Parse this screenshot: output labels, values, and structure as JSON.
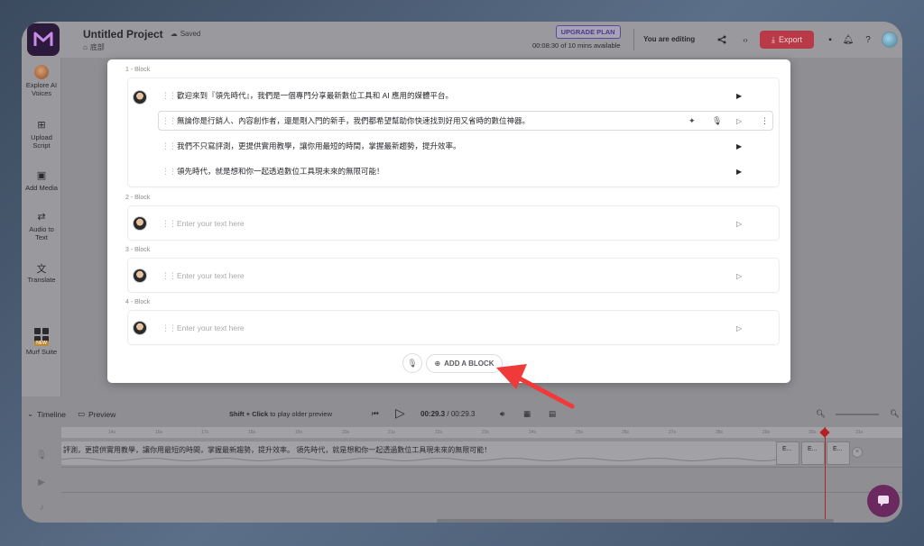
{
  "header": {
    "project_title": "Untitled Project",
    "saved_label": "Saved",
    "breadcrumb": "底部",
    "upgrade_label": "UPGRADE PLAN",
    "time_left": "00:08:30 of 10 mins available",
    "editing_label": "You are editing",
    "export_label": "Export"
  },
  "sidebar": {
    "items": [
      {
        "label": "Explore AI Voices",
        "icon": "voice-avatar-icon"
      },
      {
        "label": "Upload Script",
        "icon": "upload-script-icon"
      },
      {
        "label": "Add Media",
        "icon": "add-media-icon"
      },
      {
        "label": "Audio to Text",
        "icon": "audio-to-text-icon"
      },
      {
        "label": "Translate",
        "icon": "translate-icon"
      },
      {
        "label": "Murf Suite",
        "icon": "murf-suite-icon",
        "badge": "NEW"
      }
    ]
  },
  "blocks": [
    {
      "label": "1 -  Block",
      "lines": [
        "歡迎來到『領先時代』，我們是一個專門分享最新數位工具和 AI 應用的媒體平台。",
        "無論你是行銷人、內容創作者，還是剛入門的新手，我們都希望幫助你快速找到好用又省時的數位神器。",
        "我們不只寫評測，更提供實用教學，讓你用最短的時間，掌握最新趨勢，提升效率。",
        "領先時代，就是想和你一起透過數位工具現未來的無限可能！"
      ]
    },
    {
      "label": "2 -  Block",
      "placeholder": "Enter your text here"
    },
    {
      "label": "3 -  Block",
      "placeholder": "Enter your text here"
    },
    {
      "label": "4 -  Block",
      "placeholder": "Enter your text here"
    }
  ],
  "add_block_label": "ADD A BLOCK",
  "timeline": {
    "label": "Timeline",
    "preview_label": "Preview",
    "hint_bold": "Shift + Click",
    "hint_rest": " to play older preview",
    "current_time": "00:29.3",
    "separator": " / ",
    "total_time": "00:29.3",
    "clip_text": "評測，更提供實用教學，讓你用最短的時間，掌握最新趨勢，提升效率。 領先時代，就是想和你一起透過數位工具現未來的無限可能！",
    "mini_clips": [
      "E...",
      "E...",
      "E..."
    ],
    "ticks": [
      "14s",
      "16s",
      "17s",
      "18s",
      "19s",
      "20s",
      "21s",
      "22s",
      "23s",
      "24s",
      "25s",
      "26s",
      "27s",
      "28s",
      "29s",
      "30s",
      "31s"
    ]
  },
  "colors": {
    "accent": "#b83a46",
    "playhead": "#b52020",
    "chat": "#6a2a60",
    "arrow": "#f03a3a"
  }
}
